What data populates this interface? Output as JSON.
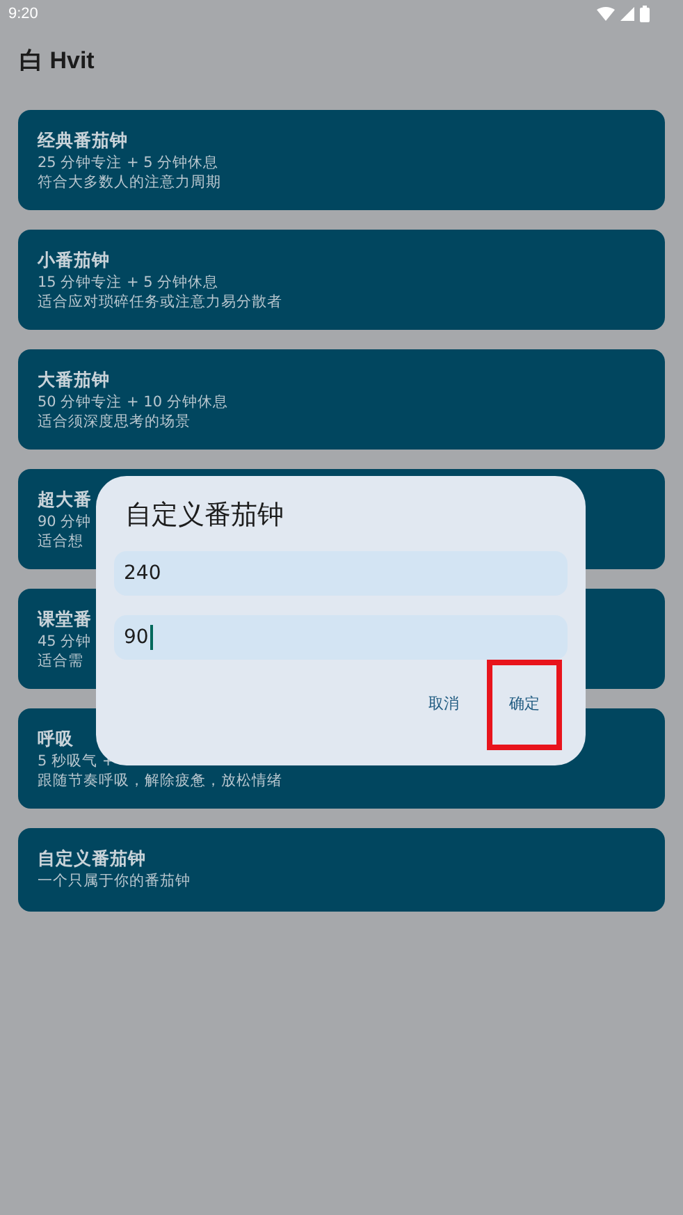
{
  "status_bar": {
    "time": "9:20"
  },
  "app_bar": {
    "title": "白 Hvit"
  },
  "cards": [
    {
      "title": "经典番茄钟",
      "lines": [
        "25 分钟专注 + 5 分钟休息",
        "符合大多数人的注意力周期"
      ]
    },
    {
      "title": "小番茄钟",
      "lines": [
        "15 分钟专注 + 5 分钟休息",
        "适合应对琐碎任务或注意力易分散者"
      ]
    },
    {
      "title": "大番茄钟",
      "lines": [
        "50 分钟专注 + 10 分钟休息",
        "适合须深度思考的场景"
      ]
    },
    {
      "title": "超大番",
      "lines": [
        "90 分钟",
        "适合想"
      ]
    },
    {
      "title": "课堂番",
      "lines": [
        "45 分钟",
        "适合需"
      ]
    },
    {
      "title": "呼吸",
      "lines": [
        "5 秒吸气 +",
        "跟随节奏呼吸，解除疲惫，放松情绪"
      ]
    },
    {
      "title": "自定义番茄钟",
      "lines": [
        "一个只属于你的番茄钟"
      ]
    }
  ],
  "dialog": {
    "title": "自定义番茄钟",
    "fields": [
      {
        "value": "240",
        "focused": false
      },
      {
        "value": "90",
        "focused": true
      }
    ],
    "buttons": [
      {
        "label": "取消",
        "highlighted": false
      },
      {
        "label": "确定",
        "highlighted": true
      }
    ]
  }
}
